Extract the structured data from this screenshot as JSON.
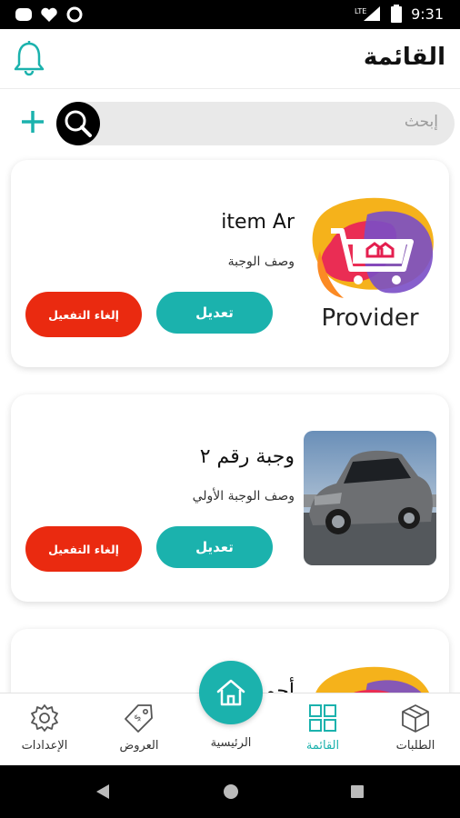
{
  "status_bar": {
    "time": "9:31",
    "network": "LTE"
  },
  "header": {
    "title": "القائمة"
  },
  "search": {
    "placeholder": "إبحث"
  },
  "items": [
    {
      "title": "item Ar",
      "description": "وصف الوجبة",
      "image": "provider-logo",
      "logo_text": "Provider",
      "edit_label": "تعديل",
      "deactivate_label": "إلغاء التفعيل"
    },
    {
      "title": "وجبة رقم ٢",
      "description": "وصف الوجبة الأولي",
      "image": "car-photo",
      "edit_label": "تعديل",
      "deactivate_label": "إلغاء التفعيل"
    },
    {
      "title": "أحمد",
      "image": "provider-logo"
    }
  ],
  "bottom_nav": {
    "items": [
      {
        "label": "الإعدادات",
        "icon": "gear-icon"
      },
      {
        "label": "العروض",
        "icon": "tag-icon"
      },
      {
        "label": "الرئيسية",
        "icon": "home-icon"
      },
      {
        "label": "القائمة",
        "icon": "grid-icon",
        "active": true
      },
      {
        "label": "الطلبات",
        "icon": "box-icon"
      }
    ]
  },
  "colors": {
    "accent": "#1bb2ad",
    "danger": "#ea2a10",
    "search_bg": "#e9e9e9"
  }
}
